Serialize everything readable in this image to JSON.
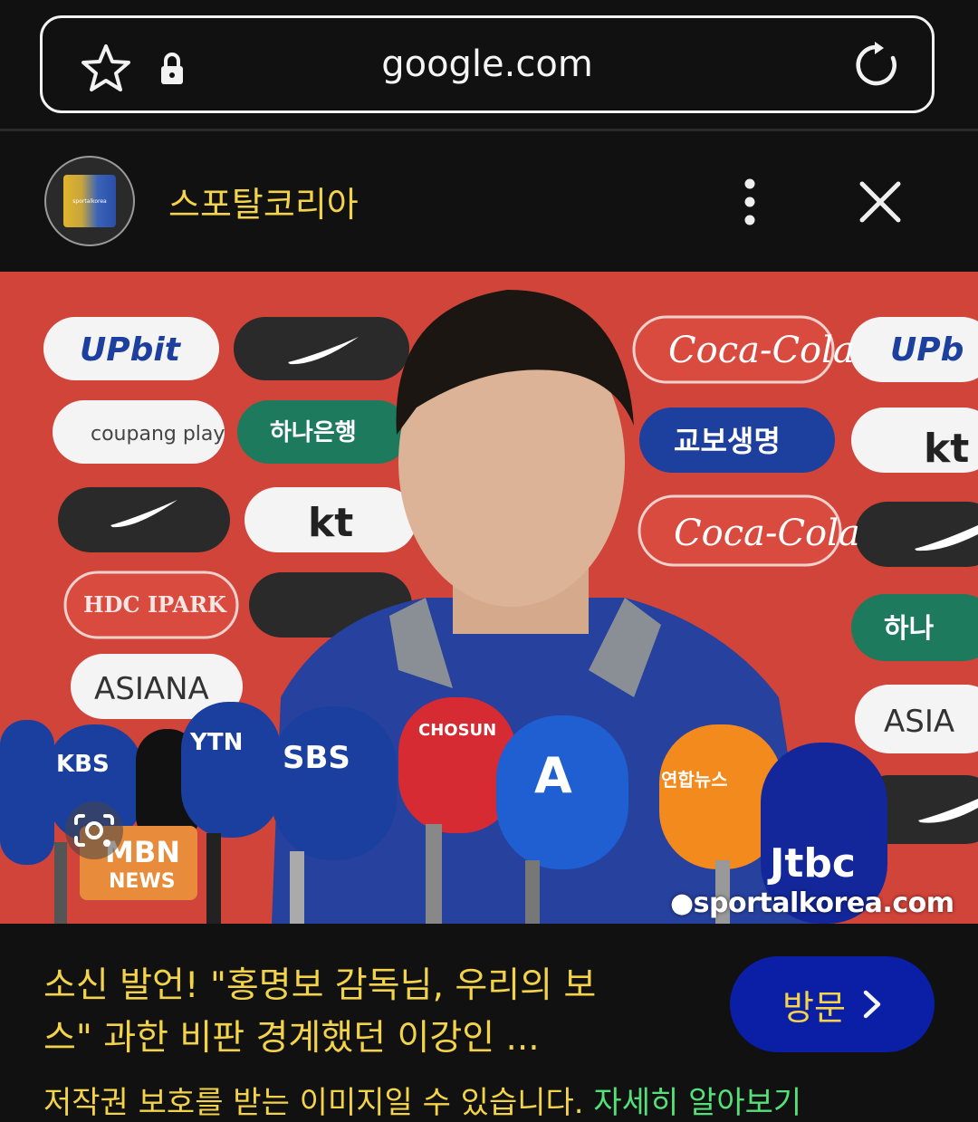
{
  "browser": {
    "domain": "google.com",
    "icons": [
      "star-icon",
      "lock-icon",
      "reload-icon"
    ]
  },
  "source": {
    "name": "스포탈코리아",
    "logo_text": "sportalkorea",
    "icons": [
      "more-vertical-icon",
      "close-icon"
    ]
  },
  "image": {
    "watermark": "●sportalkorea.com",
    "sponsor_boards": [
      "UPbit",
      "coupang play",
      "하나은행",
      "kt",
      "HDC IPARK",
      "ASIANA",
      "Coca-Cola",
      "교보생명",
      "ASIA"
    ],
    "mics": [
      "KBS",
      "YTN",
      "SBS",
      "TV CHOSUN",
      "A",
      "연합뉴스TV",
      "JTBC",
      "MBN NEWS"
    ]
  },
  "article": {
    "headline_line1": "소신 발언! \"홍명보 감독님, 우리의 보",
    "headline_line2": "스\" 과한 비판 경계했던 이강인 ...",
    "visit_label": "방문",
    "cutoff_text": "저작권 보호를 받는 이미지일 수 있습니다.",
    "cutoff_link": "자세히 알아보기"
  },
  "colors": {
    "accent_text": "#f3d34a",
    "visit_button": "#0a1ea6",
    "background": "#111111"
  }
}
